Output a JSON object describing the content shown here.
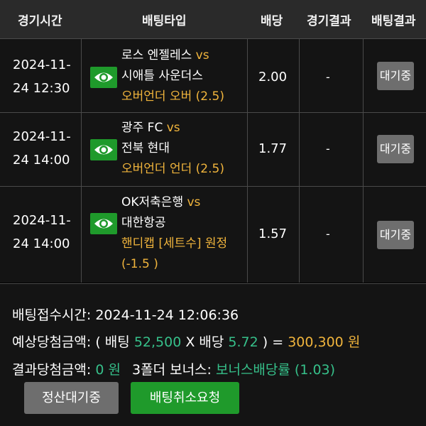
{
  "header": {
    "col_time": "경기시간",
    "col_type": "배팅타입",
    "col_odds": "배당",
    "col_result": "경기결과",
    "col_bet_result": "배팅결과"
  },
  "rows": [
    {
      "time_line1": "2024-11-",
      "time_line2": "24 12:30",
      "home": "로스 엔젤레스",
      "vs": "vs",
      "away": "시애틀 사운더스",
      "pick_line1": "오버언더 오버 (2.5)",
      "pick_line2": "",
      "odds": "2.00",
      "result": "-",
      "status": "대기중"
    },
    {
      "time_line1": "2024-11-",
      "time_line2": "24 14:00",
      "home": "광주 FC",
      "vs": "vs",
      "away": "전북 현대",
      "pick_line1": "오버언더 언더 (2.5)",
      "pick_line2": "",
      "odds": "1.77",
      "result": "-",
      "status": "대기중"
    },
    {
      "time_line1": "2024-11-",
      "time_line2": "24 14:00",
      "home": "OK저축은행",
      "vs": "vs",
      "away": "대한항공",
      "pick_line1": "핸디캡 [세트수] 원정",
      "pick_line2": "(-1.5 )",
      "odds": "1.57",
      "result": "-",
      "status": "대기중"
    }
  ],
  "summary": {
    "receipt_label": "배팅접수시간:",
    "receipt_time": "2024-11-24 12:06:36",
    "expected_label": "예상당첨금액:",
    "expected_open": "( 배팅",
    "bet_amount": "52,500",
    "x_label": "X 배당",
    "total_odds": "5.72",
    "close_eq": ") =",
    "expected_amount": "300,300 원",
    "result_label": "결과당첨금액:",
    "result_amount": "0 원",
    "bonus_label": "3폴더 보너스:",
    "bonus_value": "보너스배당률 (1.03)"
  },
  "buttons": {
    "settle_wait": "정산대기중",
    "cancel_request": "배팅취소요청"
  },
  "colors": {
    "accent_yellow": "#f0b43c",
    "accent_green": "#36c08a",
    "button_green": "#1f9a2b",
    "button_gray": "#6e6e6e"
  }
}
